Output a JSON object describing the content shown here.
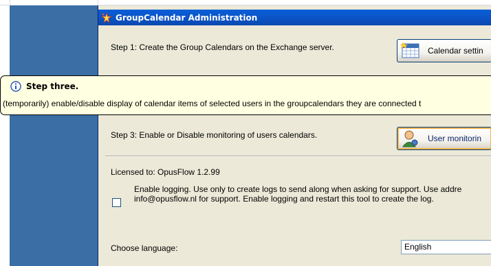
{
  "window": {
    "title": "GroupCalendar Administration"
  },
  "steps": {
    "step1_text": "Step 1: Create the Group Calendars on the Exchange server.",
    "step1_button": "Calendar settin",
    "step3_text": "Step 3: Enable or Disable monitoring of users calendars.",
    "step3_button": "User monitorin"
  },
  "tooltip": {
    "title": "Step three.",
    "body": "(temporarily) enable/disable display of calendar items of selected users in the groupcalendars they are connected t"
  },
  "license": {
    "text": "Licensed to: OpusFlow 1.2.99"
  },
  "logging": {
    "checked": false,
    "line1": "Enable logging. Use only to create logs to send along when asking for support. Use addre",
    "line2": "info@opusflow.nl for support. Enable logging and restart this tool to create the log."
  },
  "language": {
    "label": "Choose language:",
    "selected": "English"
  },
  "icons": {
    "app": "sparkle-app-icon",
    "calendar_button": "calendar-icon",
    "user_button": "user-icon",
    "tooltip": "info-icon"
  },
  "colors": {
    "titlebar": "#0a5fd8",
    "window_bg": "#ece9d8",
    "tooltip_bg": "#ffffe1",
    "side_panel": "#3a6ea5"
  }
}
